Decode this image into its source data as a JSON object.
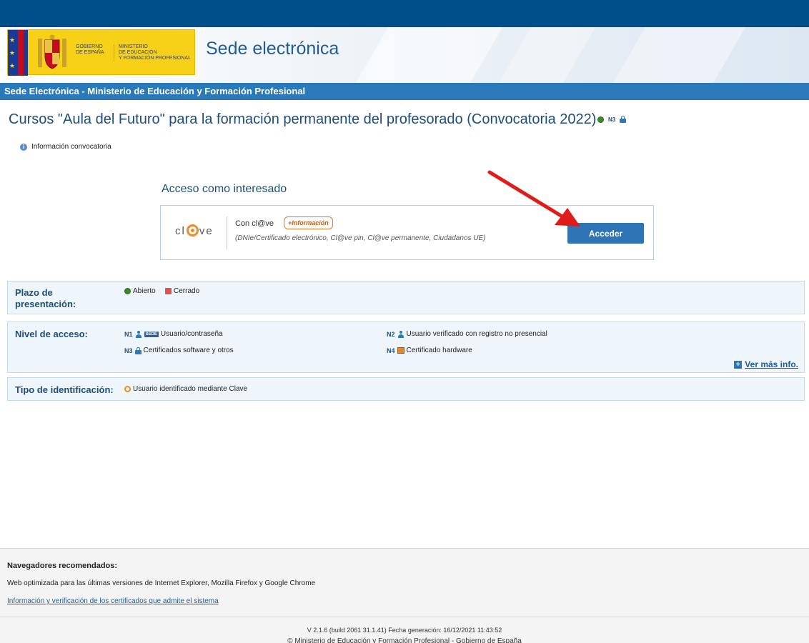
{
  "header": {
    "gov_line1": "GOBIERNO",
    "gov_line2": "DE ESPAÑA",
    "min_line1": "MINISTERIO",
    "min_line2": "DE EDUCACIÓN",
    "min_line3": "Y FORMACIÓN PROFESIONAL",
    "site_title": "Sede electrónica"
  },
  "sede_bar": {
    "text": "Sede Electrónica - Ministerio de Educación y Formación Profesional"
  },
  "page": {
    "title": "Cursos \"Aula del Futuro\" para la formación permanente del profesorado (Convocatoria 2022)",
    "level_badge": "N3",
    "info_link": "Información convocatoria"
  },
  "access": {
    "heading": "Acceso como interesado",
    "logo_text_1": "cl",
    "logo_text_2": "ve",
    "method_label": "Con cl@ve",
    "more_info": "+Información",
    "description": "(DNIe/Certificado electrónico, Cl@ve pin, Cl@ve permanente, Ciudadanos UE)",
    "button": "Acceder"
  },
  "plazo": {
    "label_1": "Plazo de",
    "label_2": "presentación:",
    "abierto": "Abierto",
    "cerrado": "Cerrado"
  },
  "nivel": {
    "label": "Nivel de acceso:",
    "n1_code": "N1",
    "n1_badge": "SEDE",
    "n1_text": "Usuario/contraseña",
    "n2_code": "N2",
    "n2_text": "Usuario verificado con registro no presencial",
    "n3_code": "N3",
    "n3_text": "Certificados software y otros",
    "n4_code": "N4",
    "n4_text": "Certificado hardware",
    "ver_mas": "Ver más info."
  },
  "tipo": {
    "label": "Tipo de identificación:",
    "value": "Usuario identificado mediante Clave"
  },
  "footer": {
    "nav_title": "Navegadores recomendados:",
    "nav_desc": "Web optimizada para las últimas versiones de Internet Explorer, Mozilla Firefox y Google Chrome",
    "nav_link": "Información y verificación de los certificados que admite el sistema",
    "version": "V 2.1.6 (build 2061 31.1.41) Fecha generación: 16/12/2021 11:43:52",
    "copyright": "© Ministerio de Educación y Formación Profesional - Gobierno de España"
  },
  "colors": {
    "top_bar": "#004f8b",
    "sede_bar": "#2b79b8",
    "button": "#2f75b5",
    "clave_orange": "#f08a24",
    "arrow": "#e01b1b"
  }
}
